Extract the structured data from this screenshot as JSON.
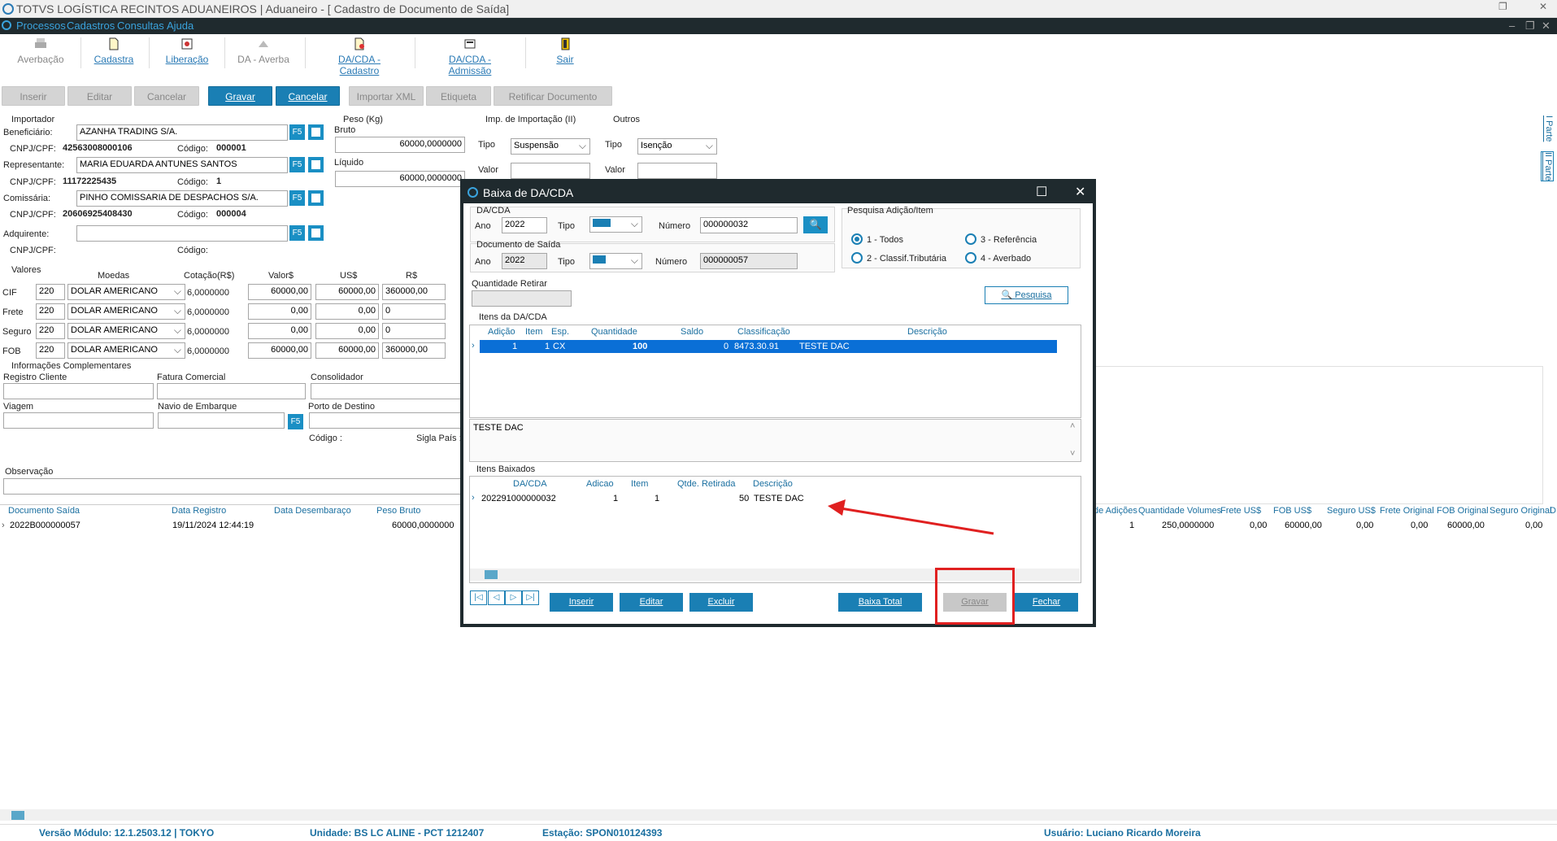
{
  "window": {
    "title": "TOTVS LOGÍSTICA RECINTOS ADUANEIROS | Aduaneiro - [ Cadastro de Documento de Saída]"
  },
  "menu": [
    "Processos",
    "Cadastros",
    "Consultas",
    "Ajuda"
  ],
  "toolbar": {
    "averbacao": "Averbação",
    "cadastra": "Cadastra",
    "liberacao": "Liberação",
    "da_averba": "DA - Averba",
    "dacda_cadastro": "DA/CDA - Cadastro",
    "dacda_admissao": "DA/CDA - Admissão",
    "sair": "Sair"
  },
  "actions": {
    "inserir": "Inserir",
    "editar": "Editar",
    "cancelar1": "Cancelar",
    "gravar": "Gravar",
    "cancelar2": "Cancelar",
    "importar_xml": "Importar XML",
    "etiqueta": "Etiqueta",
    "retificar": "Retificar Documento"
  },
  "importador": {
    "group": "Importador",
    "beneficiario_label": "Beneficiário:",
    "beneficiario": "AZANHA TRADING S/A.",
    "cnpj_label": "CNPJ/CPF:",
    "cnpj1": "42563008000106",
    "codigo_label": "Código:",
    "codigo1": "000001",
    "representante_label": "Representante:",
    "representante": "MARIA EDUARDA ANTUNES SANTOS",
    "cnpj2": "11172225435",
    "codigo2": "1",
    "comissaria_label": "Comissária:",
    "comissaria": "PINHO COMISSARIA DE DESPACHOS S/A.",
    "cnpj3": "20606925408430",
    "codigo3": "000004",
    "adquirente_label": "Adquirente:",
    "f5": "F5"
  },
  "peso": {
    "group": "Peso (Kg)",
    "bruto_label": "Bruto",
    "bruto": "60000,0000000",
    "liquido_label": "Líquido",
    "liquido": "60000,0000000"
  },
  "imp": {
    "group": "Imp. de Importação (II)",
    "tipo_label": "Tipo",
    "tipo": "Suspensão",
    "valor_label": "Valor"
  },
  "outros": {
    "group": "Outros",
    "tipo": "Isenção"
  },
  "valores": {
    "group": "Valores",
    "headers": [
      "Moedas",
      "Cotação(R$)",
      "Valor$",
      "US$",
      "R$"
    ],
    "rows": [
      {
        "label": "CIF",
        "code": "220",
        "moeda": "DOLAR AMERICANO",
        "cot": "6,0000000",
        "valor": "60000,00",
        "usd": "60000,00",
        "brl": "360000,00"
      },
      {
        "label": "Frete",
        "code": "220",
        "moeda": "DOLAR AMERICANO",
        "cot": "6,0000000",
        "valor": "0,00",
        "usd": "0,00",
        "brl": "0"
      },
      {
        "label": "Seguro",
        "code": "220",
        "moeda": "DOLAR AMERICANO",
        "cot": "6,0000000",
        "valor": "0,00",
        "usd": "0,00",
        "brl": "0"
      },
      {
        "label": "FOB",
        "code": "220",
        "moeda": "DOLAR AMERICANO",
        "cot": "6,0000000",
        "valor": "60000,00",
        "usd": "60000,00",
        "brl": "360000,00"
      }
    ]
  },
  "info": {
    "group": "Informações Complementares",
    "registro_cliente": "Registro Cliente",
    "fatura": "Fatura Comercial",
    "consolidador": "Consolidador",
    "viagem": "Viagem",
    "navio": "Navio de Embarque",
    "porto": "Porto de Destino",
    "codigo": "Código :",
    "sigla": "Sigla País :",
    "observacao": "Observação"
  },
  "bg_grid": {
    "left_headers": [
      "Documento Saída",
      "Data Registro",
      "Data  Desembaraço",
      "Peso Bruto"
    ],
    "left_row": [
      "2022B000000057",
      "19/11/2024 12:44:19",
      "",
      "60000,0000000"
    ],
    "right_headers": [
      "de Adições",
      "Quantidade Volumes",
      "Frete US$",
      "FOB US$",
      "Seguro US$",
      "Frete Original",
      "FOB Original",
      "Seguro Original",
      "D"
    ],
    "right_row": [
      "1",
      "250,0000000",
      "0,00",
      "60000,00",
      "0,00",
      "0,00",
      "60000,00",
      "0,00"
    ]
  },
  "right_tabs": [
    "I Parte",
    "II Parte"
  ],
  "status": {
    "versao": "Versão Módulo:  12.1.2503.12  |  TOKYO",
    "unidade": "Unidade: BS LC ALINE - PCT 1212407",
    "estacao": "Estação: SPON010124393",
    "usuario": "Usuário: Luciano Ricardo Moreira"
  },
  "modal": {
    "title": "Baixa de DA/CDA",
    "dacda_group": "DA/CDA",
    "ano_label": "Ano",
    "ano1": "2022",
    "tipo_label": "Tipo",
    "numero_label": "Número",
    "numero1": "000000032",
    "docsaida_group": "Documento de Saída",
    "ano2": "2022",
    "numero2": "000000057",
    "qtd_retirar_label": "Quantidade Retirar",
    "pesquisa_group": "Pesquisa Adição/Item",
    "radios": [
      "1 - Todos",
      "3 - Referência",
      "2 - Classif.Tributária",
      "4 - Averbado"
    ],
    "pesquisa_btn": "Pesquisa",
    "itens_group": "Itens da DA/CDA",
    "itens_headers": [
      "Adição",
      "Item",
      "Esp.",
      "Quantidade",
      "Saldo",
      "Classificação",
      "Descrição"
    ],
    "itens_row": [
      "1",
      "1",
      "CX",
      "100",
      "0",
      "8473.30.91",
      "TESTE DAC"
    ],
    "memo": "TESTE DAC",
    "baixados_group": "Itens Baixados",
    "baixados_headers": [
      "DA/CDA",
      "Adicao",
      "Item",
      "Qtde. Retirada",
      "Descrição"
    ],
    "baixados_row": [
      "202291000000032",
      "1",
      "1",
      "50",
      "TESTE DAC"
    ],
    "btn_inserir": "Inserir",
    "btn_editar": "Editar",
    "btn_excluir": "Excluir",
    "btn_baixa_total": "Baixa Total",
    "btn_gravar": "Gravar",
    "btn_fechar": "Fechar"
  },
  "colors": {
    "accent": "#1a7fb4",
    "dark": "#1f2a2e",
    "highlight_red": "#e02020",
    "selection": "#0a6fd6"
  }
}
